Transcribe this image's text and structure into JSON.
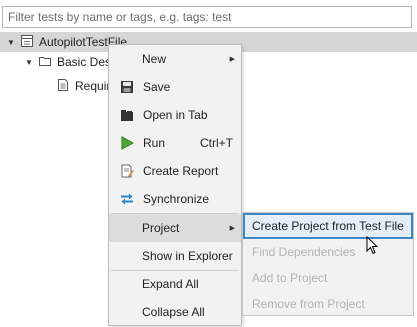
{
  "filter": {
    "placeholder": "Filter tests by name or tags, e.g. tags: test"
  },
  "tree": [
    {
      "label": "AutopilotTestFile",
      "expanded": true,
      "selected": true,
      "icon": "test-file-icon"
    },
    {
      "label": "Basic Design Test Cases",
      "expanded": true,
      "icon": "folder-icon"
    },
    {
      "label": "Requirements Tests",
      "icon": "test-case-icon"
    }
  ],
  "context_menu": {
    "items": [
      {
        "label": "New",
        "has_submenu": true
      },
      {
        "label": "Save",
        "icon": "save-icon"
      },
      {
        "label": "Open in Tab",
        "icon": "open-in-tab-icon"
      },
      {
        "label": "Run",
        "icon": "run-icon",
        "shortcut": "Ctrl+T"
      },
      {
        "label": "Create Report",
        "icon": "report-icon"
      },
      {
        "label": "Synchronize",
        "icon": "synchronize-icon"
      },
      {
        "label": "Project",
        "has_submenu": true,
        "active": true
      },
      {
        "label": "Show in Explorer"
      },
      {
        "label": "Expand All"
      },
      {
        "label": "Collapse All"
      }
    ]
  },
  "project_submenu": {
    "items": [
      {
        "label": "Create Project from Test File",
        "enabled": true,
        "highlighted": true
      },
      {
        "label": "Find Dependencies",
        "enabled": false
      },
      {
        "label": "Add to Project",
        "enabled": false
      },
      {
        "label": "Remove from Project",
        "enabled": false
      }
    ]
  },
  "colors": {
    "selection_row": "#d6d6d6",
    "menu_bg": "#f2f2f2",
    "highlight_border": "#3e86c6",
    "disabled_text": "#b3b3b3"
  }
}
